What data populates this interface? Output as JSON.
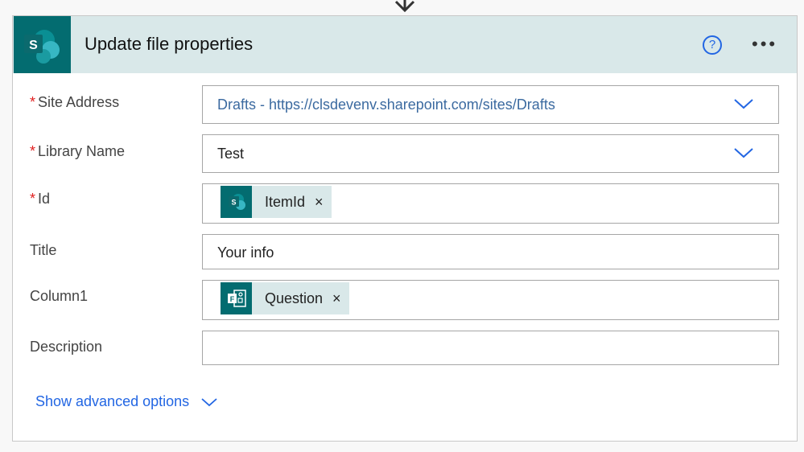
{
  "action": {
    "title": "Update file properties",
    "help_label": "?",
    "more_label": "•••"
  },
  "fields": [
    {
      "label": "Site Address",
      "required": true,
      "value": "Drafts - https://clsdevenv.sharepoint.com/sites/Drafts"
    },
    {
      "label": "Library Name",
      "required": true,
      "value": "Test"
    },
    {
      "label": "Id",
      "required": true,
      "token": "ItemId"
    },
    {
      "label": "Title",
      "required": false,
      "value": "Your info"
    },
    {
      "label": "Column1",
      "required": false,
      "token": "Question"
    },
    {
      "label": "Description",
      "required": false,
      "value": ""
    }
  ],
  "required_mark": "*",
  "token_remove": "×",
  "advanced": {
    "label": "Show advanced options"
  },
  "colors": {
    "accent": "#2266e3",
    "sharepoint": "#036c70",
    "header_bg": "#d9e8e9"
  }
}
